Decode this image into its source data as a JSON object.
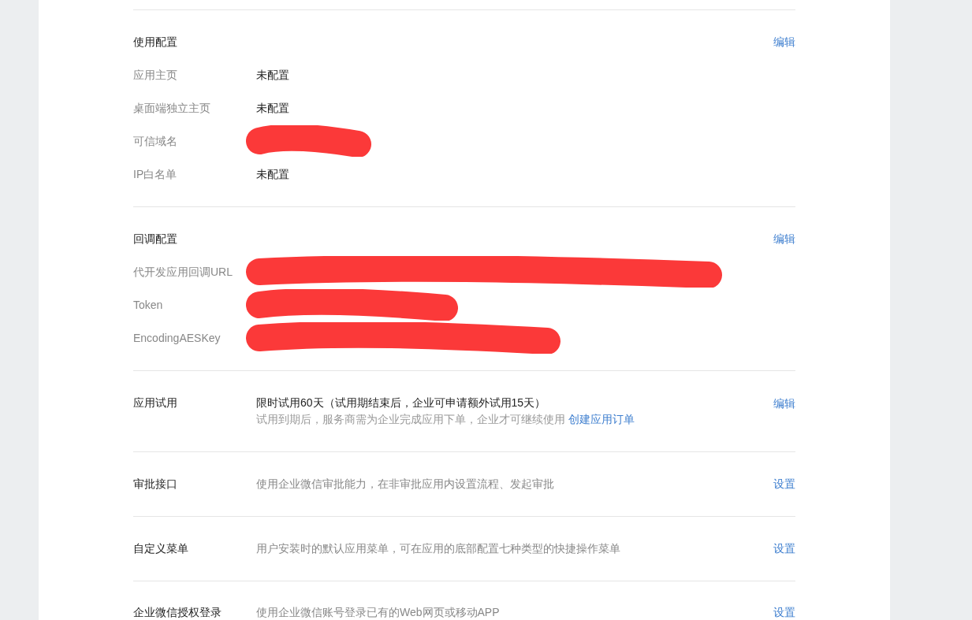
{
  "config_sections": [
    {
      "title": "使用配置",
      "action": "编辑",
      "fields": [
        {
          "label": "应用主页",
          "value": "未配置",
          "redacted": false
        },
        {
          "label": "桌面端独立主页",
          "value": "未配置",
          "redacted": false
        },
        {
          "label": "可信域名",
          "redacted": true
        },
        {
          "label": "IP白名单",
          "value": "未配置",
          "redacted": false
        }
      ]
    },
    {
      "title": "回调配置",
      "action": "编辑",
      "fields": [
        {
          "label": "代开发应用回调URL",
          "redacted": true
        },
        {
          "label": "Token",
          "redacted": true
        },
        {
          "label": "EncodingAESKey",
          "redacted": true
        }
      ]
    }
  ],
  "trial": {
    "title": "应用试用",
    "value": "限时试用60天（试用期结束后，企业可申请额外试用15天）",
    "note": "试用到期后，服务商需为企业完成应用下单，企业才可继续使用",
    "link": "创建应用订单",
    "action": "编辑"
  },
  "features": [
    {
      "title": "审批接口",
      "description": "使用企业微信审批能力，在非审批应用内设置流程、发起审批",
      "action": "设置"
    },
    {
      "title": "自定义菜单",
      "description": "用户安装时的默认应用菜单，可在应用的底部配置七种类型的快捷操作菜单",
      "action": "设置"
    },
    {
      "title": "企业微信授权登录",
      "description": "使用企业微信账号登录已有的Web网页或移动APP",
      "action": "设置"
    }
  ]
}
